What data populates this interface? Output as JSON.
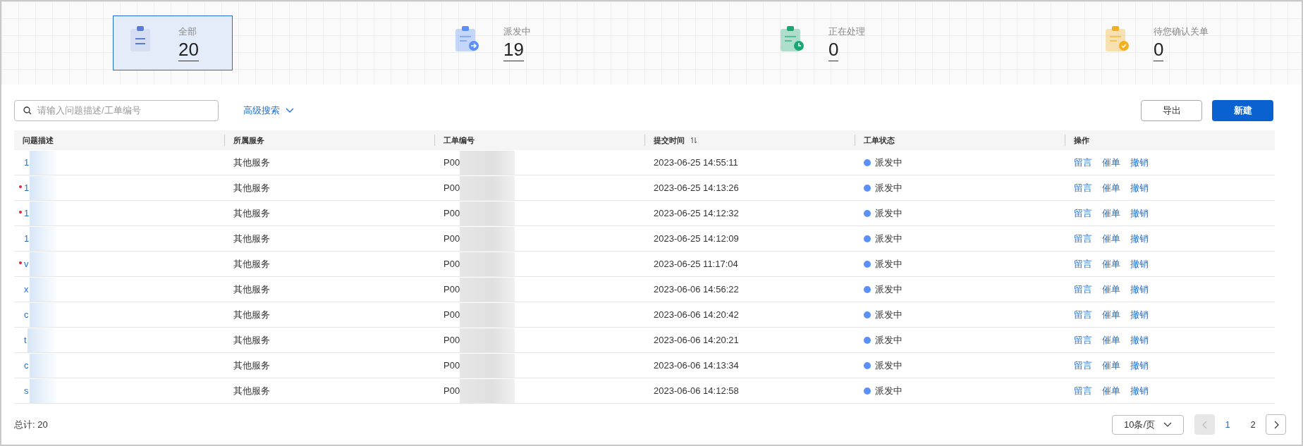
{
  "stats": [
    {
      "kind": "all",
      "label": "全部",
      "count": "20",
      "selected": true
    },
    {
      "kind": "dispatching",
      "label": "派发中",
      "count": "19",
      "selected": false
    },
    {
      "kind": "processing",
      "label": "正在处理",
      "count": "0",
      "selected": false
    },
    {
      "kind": "confirm",
      "label": "待您确认关单",
      "count": "0",
      "selected": false
    }
  ],
  "search": {
    "placeholder": "请输入问题描述/工单编号"
  },
  "advanced_search": "高级搜索",
  "buttons": {
    "export": "导出",
    "create": "新建"
  },
  "table": {
    "columns": [
      {
        "label": "问题描述",
        "sortable": false
      },
      {
        "label": "所属服务",
        "sortable": false
      },
      {
        "label": "工单编号",
        "sortable": false
      },
      {
        "label": "提交时间",
        "sortable": true
      },
      {
        "label": "工单状态",
        "sortable": false
      },
      {
        "label": "操作",
        "sortable": false
      }
    ],
    "rows": [
      {
        "description": "1",
        "unread": false,
        "service": "其他服务",
        "ticket": "P00",
        "time": "2023-06-25 14:55:11",
        "status": "派发中",
        "actions": [
          "留言",
          "催单",
          "撤销"
        ]
      },
      {
        "description": "1",
        "unread": true,
        "service": "其他服务",
        "ticket": "P00",
        "time": "2023-06-25 14:13:26",
        "status": "派发中",
        "actions": [
          "留言",
          "催单",
          "撤销"
        ]
      },
      {
        "description": "1",
        "unread": true,
        "service": "其他服务",
        "ticket": "P00",
        "time": "2023-06-25 14:12:32",
        "status": "派发中",
        "actions": [
          "留言",
          "催单",
          "撤销"
        ]
      },
      {
        "description": "1",
        "unread": false,
        "service": "其他服务",
        "ticket": "P00",
        "time": "2023-06-25 14:12:09",
        "status": "派发中",
        "actions": [
          "留言",
          "催单",
          "撤销"
        ]
      },
      {
        "description": "v",
        "unread": true,
        "service": "其他服务",
        "ticket": "P00",
        "time": "2023-06-25 11:17:04",
        "status": "派发中",
        "actions": [
          "留言",
          "催单",
          "撤销"
        ]
      },
      {
        "description": "x",
        "unread": false,
        "service": "其他服务",
        "ticket": "P00",
        "time": "2023-06-06 14:56:22",
        "status": "派发中",
        "actions": [
          "留言",
          "催单",
          "撤销"
        ]
      },
      {
        "description": "c",
        "unread": false,
        "service": "其他服务",
        "ticket": "P00",
        "time": "2023-06-06 14:20:42",
        "status": "派发中",
        "actions": [
          "留言",
          "催单",
          "撤销"
        ]
      },
      {
        "description": "t",
        "unread": false,
        "service": "其他服务",
        "ticket": "P00",
        "time": "2023-06-06 14:20:21",
        "status": "派发中",
        "actions": [
          "留言",
          "催单",
          "撤销"
        ]
      },
      {
        "description": "c",
        "unread": false,
        "service": "其他服务",
        "ticket": "P00",
        "time": "2023-06-06 14:13:34",
        "status": "派发中",
        "actions": [
          "留言",
          "催单",
          "撤销"
        ]
      },
      {
        "description": "s",
        "unread": false,
        "service": "其他服务",
        "ticket": "P00",
        "time": "2023-06-06 14:12:58",
        "status": "派发中",
        "actions": [
          "留言",
          "催单",
          "撤销"
        ]
      }
    ]
  },
  "total": "总计: 20",
  "pagination": {
    "page_size": "10条/页",
    "prev_disabled": true,
    "pages": [
      {
        "label": "1",
        "selected": true
      },
      {
        "label": "2",
        "selected": false
      }
    ]
  }
}
